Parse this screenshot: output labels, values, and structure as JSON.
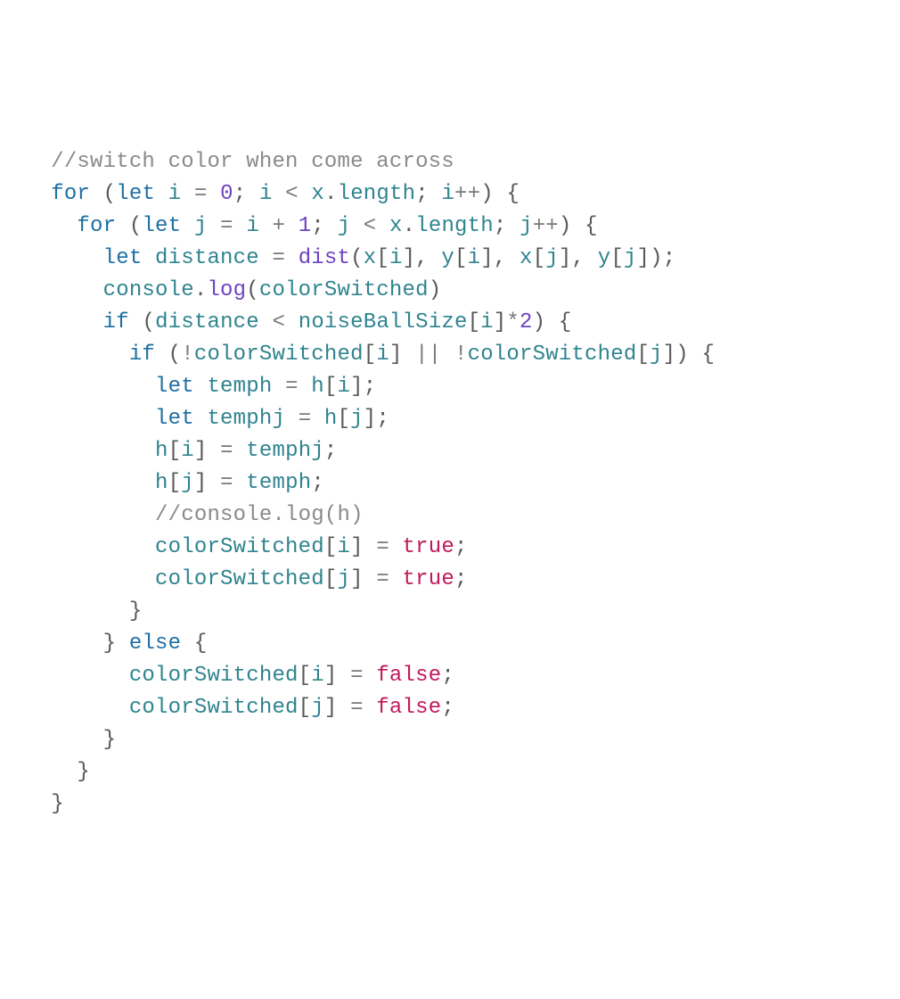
{
  "code": {
    "lines": [
      {
        "indent": 1,
        "tokens": [
          {
            "cls": "tok-comment",
            "text": "//switch color when come across"
          }
        ]
      },
      {
        "indent": 1,
        "tokens": [
          {
            "cls": "tok-keyword",
            "text": "for"
          },
          {
            "cls": "tok-text",
            "text": " "
          },
          {
            "cls": "tok-punct",
            "text": "("
          },
          {
            "cls": "tok-keyword",
            "text": "let"
          },
          {
            "cls": "tok-text",
            "text": " "
          },
          {
            "cls": "tok-ident",
            "text": "i"
          },
          {
            "cls": "tok-text",
            "text": " "
          },
          {
            "cls": "tok-op",
            "text": "="
          },
          {
            "cls": "tok-text",
            "text": " "
          },
          {
            "cls": "tok-num",
            "text": "0"
          },
          {
            "cls": "tok-punct",
            "text": ";"
          },
          {
            "cls": "tok-text",
            "text": " "
          },
          {
            "cls": "tok-ident",
            "text": "i"
          },
          {
            "cls": "tok-text",
            "text": " "
          },
          {
            "cls": "tok-op",
            "text": "<"
          },
          {
            "cls": "tok-text",
            "text": " "
          },
          {
            "cls": "tok-ident",
            "text": "x"
          },
          {
            "cls": "tok-punct",
            "text": "."
          },
          {
            "cls": "tok-ident",
            "text": "length"
          },
          {
            "cls": "tok-punct",
            "text": ";"
          },
          {
            "cls": "tok-text",
            "text": " "
          },
          {
            "cls": "tok-ident",
            "text": "i"
          },
          {
            "cls": "tok-op",
            "text": "++"
          },
          {
            "cls": "tok-punct",
            "text": ")"
          },
          {
            "cls": "tok-text",
            "text": " "
          },
          {
            "cls": "tok-punct",
            "text": "{"
          }
        ]
      },
      {
        "indent": 2,
        "tokens": [
          {
            "cls": "tok-keyword",
            "text": "for"
          },
          {
            "cls": "tok-text",
            "text": " "
          },
          {
            "cls": "tok-punct",
            "text": "("
          },
          {
            "cls": "tok-keyword",
            "text": "let"
          },
          {
            "cls": "tok-text",
            "text": " "
          },
          {
            "cls": "tok-ident",
            "text": "j"
          },
          {
            "cls": "tok-text",
            "text": " "
          },
          {
            "cls": "tok-op",
            "text": "="
          },
          {
            "cls": "tok-text",
            "text": " "
          },
          {
            "cls": "tok-ident",
            "text": "i"
          },
          {
            "cls": "tok-text",
            "text": " "
          },
          {
            "cls": "tok-op",
            "text": "+"
          },
          {
            "cls": "tok-text",
            "text": " "
          },
          {
            "cls": "tok-num",
            "text": "1"
          },
          {
            "cls": "tok-punct",
            "text": ";"
          },
          {
            "cls": "tok-text",
            "text": " "
          },
          {
            "cls": "tok-ident",
            "text": "j"
          },
          {
            "cls": "tok-text",
            "text": " "
          },
          {
            "cls": "tok-op",
            "text": "<"
          },
          {
            "cls": "tok-text",
            "text": " "
          },
          {
            "cls": "tok-ident",
            "text": "x"
          },
          {
            "cls": "tok-punct",
            "text": "."
          },
          {
            "cls": "tok-ident",
            "text": "length"
          },
          {
            "cls": "tok-punct",
            "text": ";"
          },
          {
            "cls": "tok-text",
            "text": " "
          },
          {
            "cls": "tok-ident",
            "text": "j"
          },
          {
            "cls": "tok-op",
            "text": "++"
          },
          {
            "cls": "tok-punct",
            "text": ")"
          },
          {
            "cls": "tok-text",
            "text": " "
          },
          {
            "cls": "tok-punct",
            "text": "{"
          }
        ]
      },
      {
        "indent": 3,
        "tokens": [
          {
            "cls": "tok-keyword",
            "text": "let"
          },
          {
            "cls": "tok-text",
            "text": " "
          },
          {
            "cls": "tok-ident",
            "text": "distance"
          },
          {
            "cls": "tok-text",
            "text": " "
          },
          {
            "cls": "tok-op",
            "text": "="
          },
          {
            "cls": "tok-text",
            "text": " "
          },
          {
            "cls": "tok-func",
            "text": "dist"
          },
          {
            "cls": "tok-punct",
            "text": "("
          },
          {
            "cls": "tok-ident",
            "text": "x"
          },
          {
            "cls": "tok-punct",
            "text": "["
          },
          {
            "cls": "tok-ident",
            "text": "i"
          },
          {
            "cls": "tok-punct",
            "text": "]"
          },
          {
            "cls": "tok-punct",
            "text": ","
          },
          {
            "cls": "tok-text",
            "text": " "
          },
          {
            "cls": "tok-ident",
            "text": "y"
          },
          {
            "cls": "tok-punct",
            "text": "["
          },
          {
            "cls": "tok-ident",
            "text": "i"
          },
          {
            "cls": "tok-punct",
            "text": "]"
          },
          {
            "cls": "tok-punct",
            "text": ","
          },
          {
            "cls": "tok-text",
            "text": " "
          },
          {
            "cls": "tok-ident",
            "text": "x"
          },
          {
            "cls": "tok-punct",
            "text": "["
          },
          {
            "cls": "tok-ident",
            "text": "j"
          },
          {
            "cls": "tok-punct",
            "text": "]"
          },
          {
            "cls": "tok-punct",
            "text": ","
          },
          {
            "cls": "tok-text",
            "text": " "
          },
          {
            "cls": "tok-ident",
            "text": "y"
          },
          {
            "cls": "tok-punct",
            "text": "["
          },
          {
            "cls": "tok-ident",
            "text": "j"
          },
          {
            "cls": "tok-punct",
            "text": "]"
          },
          {
            "cls": "tok-punct",
            "text": ")"
          },
          {
            "cls": "tok-punct",
            "text": ";"
          }
        ]
      },
      {
        "indent": 3,
        "tokens": [
          {
            "cls": "tok-ident",
            "text": "console"
          },
          {
            "cls": "tok-punct",
            "text": "."
          },
          {
            "cls": "tok-func",
            "text": "log"
          },
          {
            "cls": "tok-punct",
            "text": "("
          },
          {
            "cls": "tok-ident",
            "text": "colorSwitched"
          },
          {
            "cls": "tok-punct",
            "text": ")"
          }
        ]
      },
      {
        "indent": 3,
        "tokens": [
          {
            "cls": "tok-keyword",
            "text": "if"
          },
          {
            "cls": "tok-text",
            "text": " "
          },
          {
            "cls": "tok-punct",
            "text": "("
          },
          {
            "cls": "tok-ident",
            "text": "distance"
          },
          {
            "cls": "tok-text",
            "text": " "
          },
          {
            "cls": "tok-op",
            "text": "<"
          },
          {
            "cls": "tok-text",
            "text": " "
          },
          {
            "cls": "tok-ident",
            "text": "noiseBallSize"
          },
          {
            "cls": "tok-punct",
            "text": "["
          },
          {
            "cls": "tok-ident",
            "text": "i"
          },
          {
            "cls": "tok-punct",
            "text": "]"
          },
          {
            "cls": "tok-op",
            "text": "*"
          },
          {
            "cls": "tok-num",
            "text": "2"
          },
          {
            "cls": "tok-punct",
            "text": ")"
          },
          {
            "cls": "tok-text",
            "text": " "
          },
          {
            "cls": "tok-punct",
            "text": "{"
          }
        ]
      },
      {
        "indent": 4,
        "tokens": [
          {
            "cls": "tok-keyword",
            "text": "if"
          },
          {
            "cls": "tok-text",
            "text": " "
          },
          {
            "cls": "tok-punct",
            "text": "("
          },
          {
            "cls": "tok-op",
            "text": "!"
          },
          {
            "cls": "tok-ident",
            "text": "colorSwitched"
          },
          {
            "cls": "tok-punct",
            "text": "["
          },
          {
            "cls": "tok-ident",
            "text": "i"
          },
          {
            "cls": "tok-punct",
            "text": "]"
          },
          {
            "cls": "tok-text",
            "text": " "
          },
          {
            "cls": "tok-op",
            "text": "||"
          },
          {
            "cls": "tok-text",
            "text": " "
          },
          {
            "cls": "tok-op",
            "text": "!"
          },
          {
            "cls": "tok-ident",
            "text": "colorSwitched"
          },
          {
            "cls": "tok-punct",
            "text": "["
          },
          {
            "cls": "tok-ident",
            "text": "j"
          },
          {
            "cls": "tok-punct",
            "text": "]"
          },
          {
            "cls": "tok-punct",
            "text": ")"
          },
          {
            "cls": "tok-text",
            "text": " "
          },
          {
            "cls": "tok-punct",
            "text": "{"
          }
        ]
      },
      {
        "indent": 5,
        "tokens": [
          {
            "cls": "tok-keyword",
            "text": "let"
          },
          {
            "cls": "tok-text",
            "text": " "
          },
          {
            "cls": "tok-ident",
            "text": "temph"
          },
          {
            "cls": "tok-text",
            "text": " "
          },
          {
            "cls": "tok-op",
            "text": "="
          },
          {
            "cls": "tok-text",
            "text": " "
          },
          {
            "cls": "tok-ident",
            "text": "h"
          },
          {
            "cls": "tok-punct",
            "text": "["
          },
          {
            "cls": "tok-ident",
            "text": "i"
          },
          {
            "cls": "tok-punct",
            "text": "]"
          },
          {
            "cls": "tok-punct",
            "text": ";"
          }
        ]
      },
      {
        "indent": 5,
        "tokens": [
          {
            "cls": "tok-keyword",
            "text": "let"
          },
          {
            "cls": "tok-text",
            "text": " "
          },
          {
            "cls": "tok-ident",
            "text": "temphj"
          },
          {
            "cls": "tok-text",
            "text": " "
          },
          {
            "cls": "tok-op",
            "text": "="
          },
          {
            "cls": "tok-text",
            "text": " "
          },
          {
            "cls": "tok-ident",
            "text": "h"
          },
          {
            "cls": "tok-punct",
            "text": "["
          },
          {
            "cls": "tok-ident",
            "text": "j"
          },
          {
            "cls": "tok-punct",
            "text": "]"
          },
          {
            "cls": "tok-punct",
            "text": ";"
          }
        ]
      },
      {
        "indent": 5,
        "tokens": [
          {
            "cls": "tok-ident",
            "text": "h"
          },
          {
            "cls": "tok-punct",
            "text": "["
          },
          {
            "cls": "tok-ident",
            "text": "i"
          },
          {
            "cls": "tok-punct",
            "text": "]"
          },
          {
            "cls": "tok-text",
            "text": " "
          },
          {
            "cls": "tok-op",
            "text": "="
          },
          {
            "cls": "tok-text",
            "text": " "
          },
          {
            "cls": "tok-ident",
            "text": "temphj"
          },
          {
            "cls": "tok-punct",
            "text": ";"
          }
        ]
      },
      {
        "indent": 5,
        "tokens": [
          {
            "cls": "tok-ident",
            "text": "h"
          },
          {
            "cls": "tok-punct",
            "text": "["
          },
          {
            "cls": "tok-ident",
            "text": "j"
          },
          {
            "cls": "tok-punct",
            "text": "]"
          },
          {
            "cls": "tok-text",
            "text": " "
          },
          {
            "cls": "tok-op",
            "text": "="
          },
          {
            "cls": "tok-text",
            "text": " "
          },
          {
            "cls": "tok-ident",
            "text": "temph"
          },
          {
            "cls": "tok-punct",
            "text": ";"
          }
        ]
      },
      {
        "indent": 5,
        "tokens": [
          {
            "cls": "tok-comment",
            "text": "//console.log(h)"
          }
        ]
      },
      {
        "indent": 5,
        "tokens": [
          {
            "cls": "tok-ident",
            "text": "colorSwitched"
          },
          {
            "cls": "tok-punct",
            "text": "["
          },
          {
            "cls": "tok-ident",
            "text": "i"
          },
          {
            "cls": "tok-punct",
            "text": "]"
          },
          {
            "cls": "tok-text",
            "text": " "
          },
          {
            "cls": "tok-op",
            "text": "="
          },
          {
            "cls": "tok-text",
            "text": " "
          },
          {
            "cls": "tok-bool",
            "text": "true"
          },
          {
            "cls": "tok-punct",
            "text": ";"
          }
        ]
      },
      {
        "indent": 5,
        "tokens": [
          {
            "cls": "tok-ident",
            "text": "colorSwitched"
          },
          {
            "cls": "tok-punct",
            "text": "["
          },
          {
            "cls": "tok-ident",
            "text": "j"
          },
          {
            "cls": "tok-punct",
            "text": "]"
          },
          {
            "cls": "tok-text",
            "text": " "
          },
          {
            "cls": "tok-op",
            "text": "="
          },
          {
            "cls": "tok-text",
            "text": " "
          },
          {
            "cls": "tok-bool",
            "text": "true"
          },
          {
            "cls": "tok-punct",
            "text": ";"
          }
        ]
      },
      {
        "indent": 4,
        "tokens": [
          {
            "cls": "tok-punct",
            "text": "}"
          }
        ]
      },
      {
        "indent": 3,
        "tokens": [
          {
            "cls": "tok-punct",
            "text": "}"
          },
          {
            "cls": "tok-text",
            "text": " "
          },
          {
            "cls": "tok-keyword",
            "text": "else"
          },
          {
            "cls": "tok-text",
            "text": " "
          },
          {
            "cls": "tok-punct",
            "text": "{"
          }
        ]
      },
      {
        "indent": 4,
        "tokens": [
          {
            "cls": "tok-ident",
            "text": "colorSwitched"
          },
          {
            "cls": "tok-punct",
            "text": "["
          },
          {
            "cls": "tok-ident",
            "text": "i"
          },
          {
            "cls": "tok-punct",
            "text": "]"
          },
          {
            "cls": "tok-text",
            "text": " "
          },
          {
            "cls": "tok-op",
            "text": "="
          },
          {
            "cls": "tok-text",
            "text": " "
          },
          {
            "cls": "tok-bool",
            "text": "false"
          },
          {
            "cls": "tok-punct",
            "text": ";"
          }
        ]
      },
      {
        "indent": 4,
        "tokens": [
          {
            "cls": "tok-ident",
            "text": "colorSwitched"
          },
          {
            "cls": "tok-punct",
            "text": "["
          },
          {
            "cls": "tok-ident",
            "text": "j"
          },
          {
            "cls": "tok-punct",
            "text": "]"
          },
          {
            "cls": "tok-text",
            "text": " "
          },
          {
            "cls": "tok-op",
            "text": "="
          },
          {
            "cls": "tok-text",
            "text": " "
          },
          {
            "cls": "tok-bool",
            "text": "false"
          },
          {
            "cls": "tok-punct",
            "text": ";"
          }
        ]
      },
      {
        "indent": 3,
        "tokens": [
          {
            "cls": "tok-punct",
            "text": "}"
          }
        ]
      },
      {
        "indent": 2,
        "tokens": [
          {
            "cls": "tok-punct",
            "text": "}"
          }
        ]
      },
      {
        "indent": 1,
        "tokens": [
          {
            "cls": "tok-punct",
            "text": "}"
          }
        ]
      }
    ],
    "indent_unit": "  "
  }
}
